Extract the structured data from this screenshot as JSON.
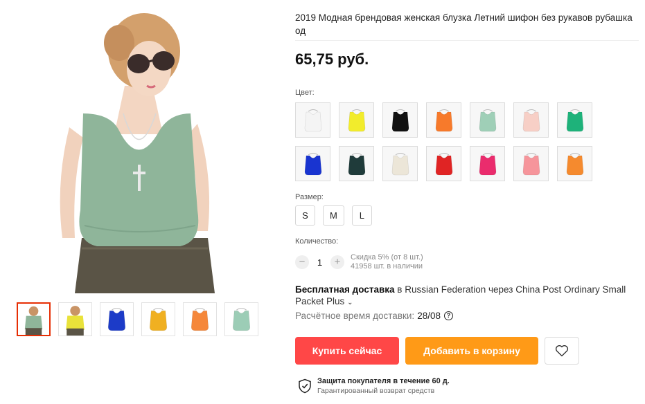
{
  "product": {
    "title": "2019 Модная брендовая женская блузка Летний шифон без рукавов рубашка од\nнотонная Повседневная блуза с вырезом Плюс Размер Свободный Топ",
    "price": "65,75 руб."
  },
  "gallery": {
    "thumbnails": [
      {
        "kind": "model",
        "color": "#8fb59a",
        "active": true
      },
      {
        "kind": "model-yellow",
        "color": "#e9e23a",
        "active": false
      },
      {
        "kind": "top",
        "color": "#1c3bc8",
        "active": false
      },
      {
        "kind": "top",
        "color": "#f0b021",
        "active": false
      },
      {
        "kind": "top",
        "color": "#f5873a",
        "active": false
      },
      {
        "kind": "top",
        "color": "#9ccdb6",
        "active": false
      }
    ]
  },
  "options": {
    "color_label": "Цвет:",
    "colors": [
      "#f4f4f4",
      "#f2ec2c",
      "#111111",
      "#f77a2b",
      "#9fcfb7",
      "#f7cfc6",
      "#1eb27a",
      "#1934d0",
      "#1f3b3a",
      "#ece6d8",
      "#e02424",
      "#ea2c6d",
      "#f6959b",
      "#f58a2e"
    ],
    "size_label": "Размер:",
    "sizes": [
      "S",
      "M",
      "L"
    ],
    "quantity_label": "Количество:",
    "quantity": "1",
    "quantity_minus": "−",
    "quantity_plus": "+",
    "discount_note": "Скидка 5% (от 8 шт.)",
    "stock_note": "41958 шт. в наличии"
  },
  "shipping": {
    "free_label": "Бесплатная доставка",
    "details": " в Russian Federation через China Post Ordinary Small Packet Plus",
    "chevron": "⌄",
    "eta_label": "Расчётное время доставки:",
    "eta_value": "28/08",
    "help": "?"
  },
  "actions": {
    "buy_now": "Купить сейчас",
    "add_to_cart": "Добавить в корзину"
  },
  "protection": {
    "title": "Защита покупателя в течение 60 д.",
    "subtitle": "Гарантированный возврат средств"
  }
}
